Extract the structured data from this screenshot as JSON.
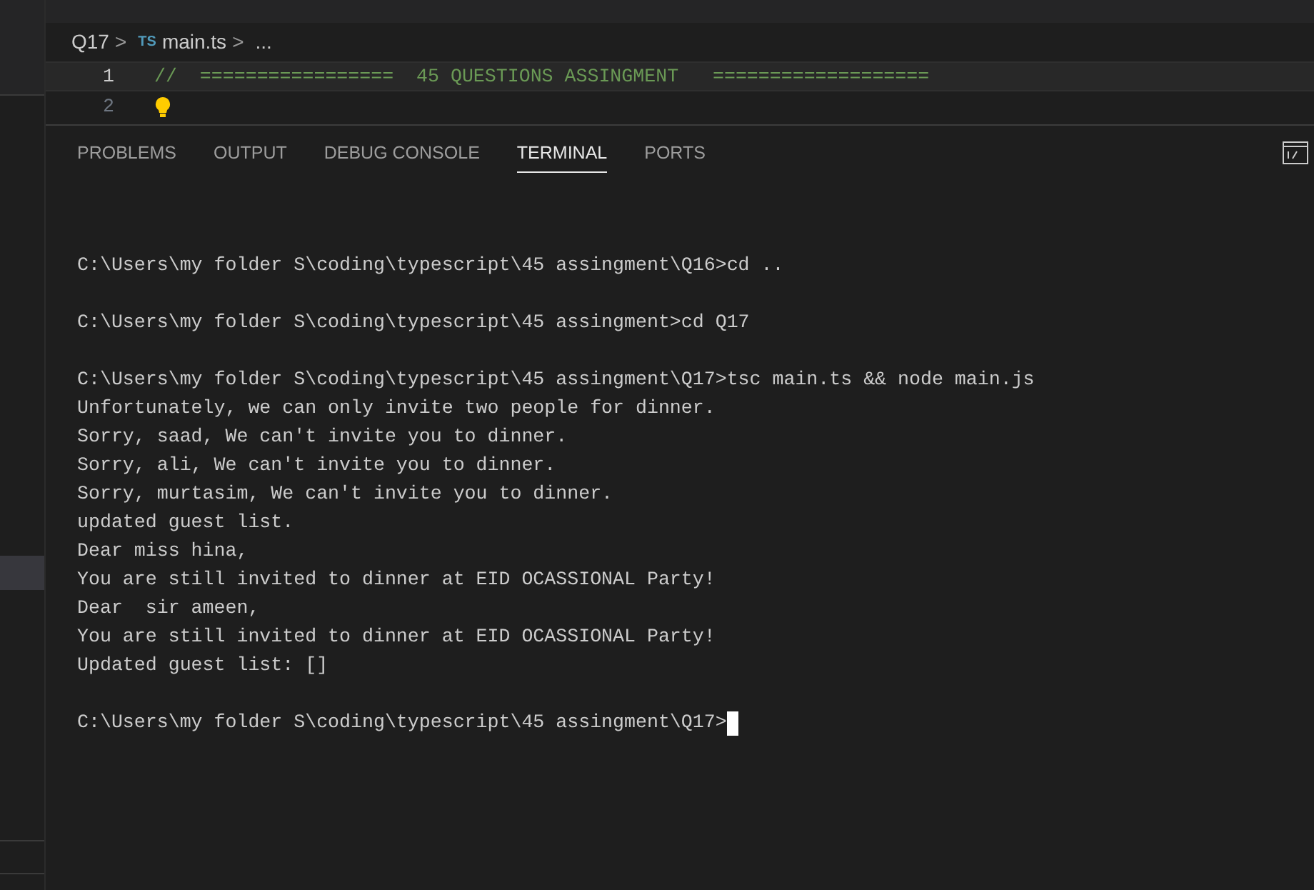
{
  "breadcrumb": {
    "folder": "Q17",
    "separator_1": ">",
    "file_badge": "TS",
    "file": "main.ts",
    "separator_2": ">",
    "symbol": "..."
  },
  "editor": {
    "lines": [
      {
        "number": "1",
        "text": "//  =================  45 QUESTIONS ASSINGMENT   ===================",
        "current": true
      },
      {
        "number": "2",
        "current": false,
        "lightbulb": true
      }
    ]
  },
  "panel_tabs": [
    {
      "label": "PROBLEMS",
      "selected": false
    },
    {
      "label": "OUTPUT",
      "selected": false
    },
    {
      "label": "DEBUG CONSOLE",
      "selected": false
    },
    {
      "label": "TERMINAL",
      "selected": true
    },
    {
      "label": "PORTS",
      "selected": false
    }
  ],
  "terminal": {
    "cursor": true,
    "blocks": [
      [
        "C:\\Users\\my folder S\\coding\\typescript\\45 assingment\\Q16>cd .."
      ],
      [
        "C:\\Users\\my folder S\\coding\\typescript\\45 assingment>cd Q17"
      ],
      [
        "C:\\Users\\my folder S\\coding\\typescript\\45 assingment\\Q17>tsc main.ts && node main.js",
        "Unfortunately, we can only invite two people for dinner.",
        "Sorry, saad, We can't invite you to dinner.",
        "Sorry, ali, We can't invite you to dinner.",
        "Sorry, murtasim, We can't invite you to dinner.",
        "updated guest list.",
        "Dear miss hina,",
        "You are still invited to dinner at EID OCASSIONAL Party!",
        "Dear  sir ameen,",
        "You are still invited to dinner at EID OCASSIONAL Party!",
        "Updated guest list: []"
      ],
      [
        "C:\\Users\\my folder S\\coding\\typescript\\45 assingment\\Q17>"
      ]
    ]
  }
}
